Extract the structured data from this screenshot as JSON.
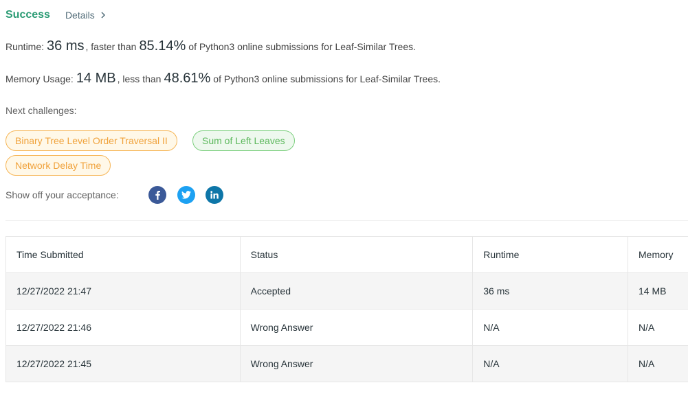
{
  "header": {
    "status": "Success",
    "details": "Details"
  },
  "runtime": {
    "label": "Runtime:",
    "value": "36 ms",
    "middle": ", faster than",
    "percent": "85.14%",
    "tail": "of Python3 online submissions for Leaf-Similar Trees."
  },
  "memory": {
    "label": "Memory Usage:",
    "value": "14 MB",
    "middle": ", less than",
    "percent": "48.61%",
    "tail": "of Python3 online submissions for Leaf-Similar Trees."
  },
  "next": {
    "label": "Next challenges:",
    "items": [
      "Binary Tree Level Order Traversal II",
      "Sum of Left Leaves",
      "Network Delay Time"
    ]
  },
  "share": {
    "label": "Show off your acceptance:"
  },
  "table": {
    "headers": [
      "Time Submitted",
      "Status",
      "Runtime",
      "Memory"
    ],
    "rows": [
      [
        "12/27/2022 21:47",
        "Accepted",
        "36 ms",
        "14 MB"
      ],
      [
        "12/27/2022 21:46",
        "Wrong Answer",
        "N/A",
        "N/A"
      ],
      [
        "12/27/2022 21:45",
        "Wrong Answer",
        "N/A",
        "N/A"
      ]
    ]
  },
  "colors": {
    "success": "#2c9c75",
    "accepted": "#2e9b78",
    "wrong": "#c62828"
  }
}
